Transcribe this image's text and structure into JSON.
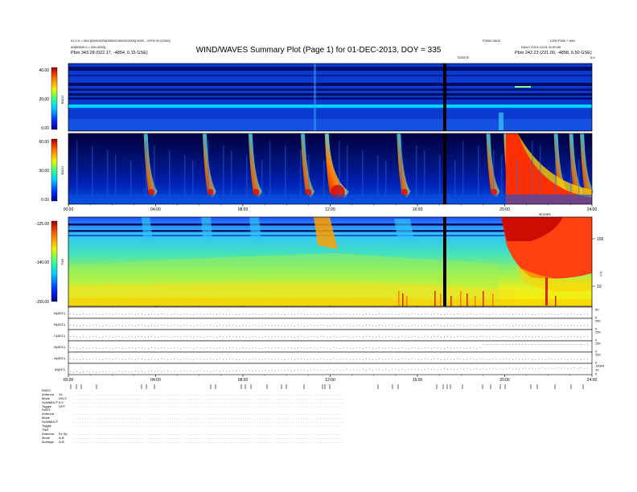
{
  "header": {
    "left_line1": "01 0.0 = 0A0 [0000:00FA000000:00000:0000] 0000 - 0:F00 00 [G000]",
    "left_line2": "A0[00000.0 = 000-0000]",
    "left_line3": "Pbm 343.28 (022.17, -4854, 0.15 GSE)",
    "right_top_a": "F0000 0A00",
    "right_top_b": "L000 F000 + 0A0",
    "right_line2": "DAILY 2013-12-01 11:00:00",
    "right_line3": "Pbm 242.23 (221.00, -4858, 6.50 GSE)",
    "marker_left": "TDS/ITE",
    "marker_right": "0:0"
  },
  "title": "WIND/WAVES Summary Plot (Page 1) for 01-DEC-2013, DOY = 335",
  "colors": {
    "background_low": "#000090",
    "rad_band": "#0a48d8",
    "burst_core": "#d01000",
    "tnr_low": "#f0e020",
    "tnr_mid": "#60e080",
    "tnr_high": "#30b8ff"
  },
  "chart_data": [
    {
      "type": "heatmap",
      "id": "RAD2",
      "ylabel": "RAD2",
      "y_ticks": [
        "40.00",
        "20.00",
        "0.00"
      ],
      "colorbar": "jet",
      "description_values": {
        "ylim": [
          0,
          40
        ]
      }
    },
    {
      "type": "heatmap",
      "id": "RAD1",
      "ylabel": "RAD1",
      "y_ticks": [
        "60.00",
        "30.00",
        "0.00"
      ],
      "ylim": [
        0,
        60
      ],
      "burst_times_h": [
        3.6,
        6.3,
        8.4,
        10.8,
        11.9,
        15.2,
        19.3,
        20.1,
        22.4,
        23.1,
        23.6
      ],
      "x_ticks": [
        "00:00",
        "04:00",
        "08:00",
        "12:00",
        "16:00",
        "20:00",
        "24:00"
      ]
    },
    {
      "type": "heatmap",
      "id": "TNR",
      "ylabel": "TNR",
      "y_ticks": [
        "-125.00",
        "-140.00",
        "-155.00"
      ],
      "ylim": [
        -155,
        -125
      ],
      "right_ticks": [
        "100",
        "10"
      ],
      "right_label": "0:0",
      "corner_label": "0EV0EE"
    },
    {
      "type": "line",
      "panels": [
        {
          "label": "B(ADC)",
          "right": [
            "50",
            "0"
          ],
          "trend": "flat"
        },
        {
          "label": "B(ADC)",
          "right": [
            "250",
            "0"
          ],
          "trend": "flat"
        },
        {
          "label": "C(ADC)",
          "right": [
            "250",
            "0"
          ],
          "trend": "flat"
        },
        {
          "label": "B(ADC)",
          "right": [
            "250",
            "0"
          ],
          "trend": "step"
        },
        {
          "label": "A(ADC)",
          "right": [
            "250",
            "0"
          ],
          "trend": "flat"
        },
        {
          "label": "|B|(NT)",
          "right": [
            "10000",
            "10",
            "0"
          ],
          "trend": "rise"
        }
      ],
      "x_ticks": [
        "00:00",
        "04:00",
        "08:00",
        "12:00",
        "16:00",
        "20:00",
        "24:00"
      ]
    }
  ],
  "table": [
    {
      "label": "RAD2",
      "value": ""
    },
    {
      "label": "Antenna",
      "value": "Xx"
    },
    {
      "label": "Mode",
      "value": "LIN 5"
    },
    {
      "label": "SUMMDLP",
      "value": "0:0"
    },
    {
      "label": "Toggle",
      "value": "OFF"
    },
    {
      "label": "RAD1",
      "value": ""
    },
    {
      "label": "Antenna",
      "value": ""
    },
    {
      "label": "Mode",
      "value": ""
    },
    {
      "label": "SUMMDLP",
      "value": ""
    },
    {
      "label": "Toggle",
      "value": ""
    },
    {
      "label": "TNR",
      "value": ""
    },
    {
      "label": "Antenna",
      "value": "Ex Sp"
    },
    {
      "label": "Mode",
      "value": "A-B"
    },
    {
      "label": "Average",
      "value": "A-B"
    }
  ]
}
